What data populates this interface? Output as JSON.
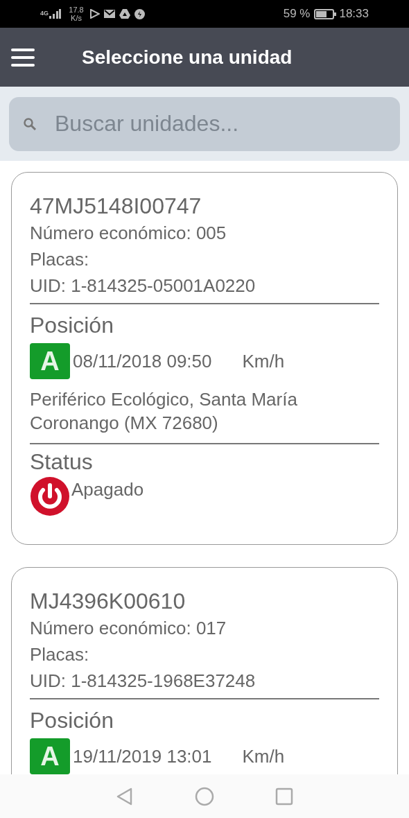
{
  "status_bar": {
    "network": "4G",
    "speed": "17.8 K/s",
    "battery": "59 %",
    "time": "18:33"
  },
  "header": {
    "title": "Seleccione una unidad"
  },
  "search": {
    "placeholder": "Buscar unidades..."
  },
  "units": [
    {
      "id": "47MJ5148I00747",
      "economic": "Número económico: 005",
      "plates": "Placas:",
      "uid": "UID: 1-814325-05001A0220",
      "position_heading": "Posición",
      "badge": "A",
      "datetime": "08/11/2018 09:50",
      "speed": "Km/h",
      "address": "Periférico Ecológico, Santa María Coronango (MX 72680)",
      "status_heading": "Status",
      "status": {
        "kind": "off",
        "label": "Apagado"
      }
    },
    {
      "id": "MJ4396K00610",
      "economic": "Número económico: 017",
      "plates": "Placas:",
      "uid": "UID: 1-814325-1968E37248",
      "position_heading": "Posición",
      "badge": "A",
      "datetime": "19/11/2019 13:01",
      "speed": "Km/h"
    }
  ]
}
